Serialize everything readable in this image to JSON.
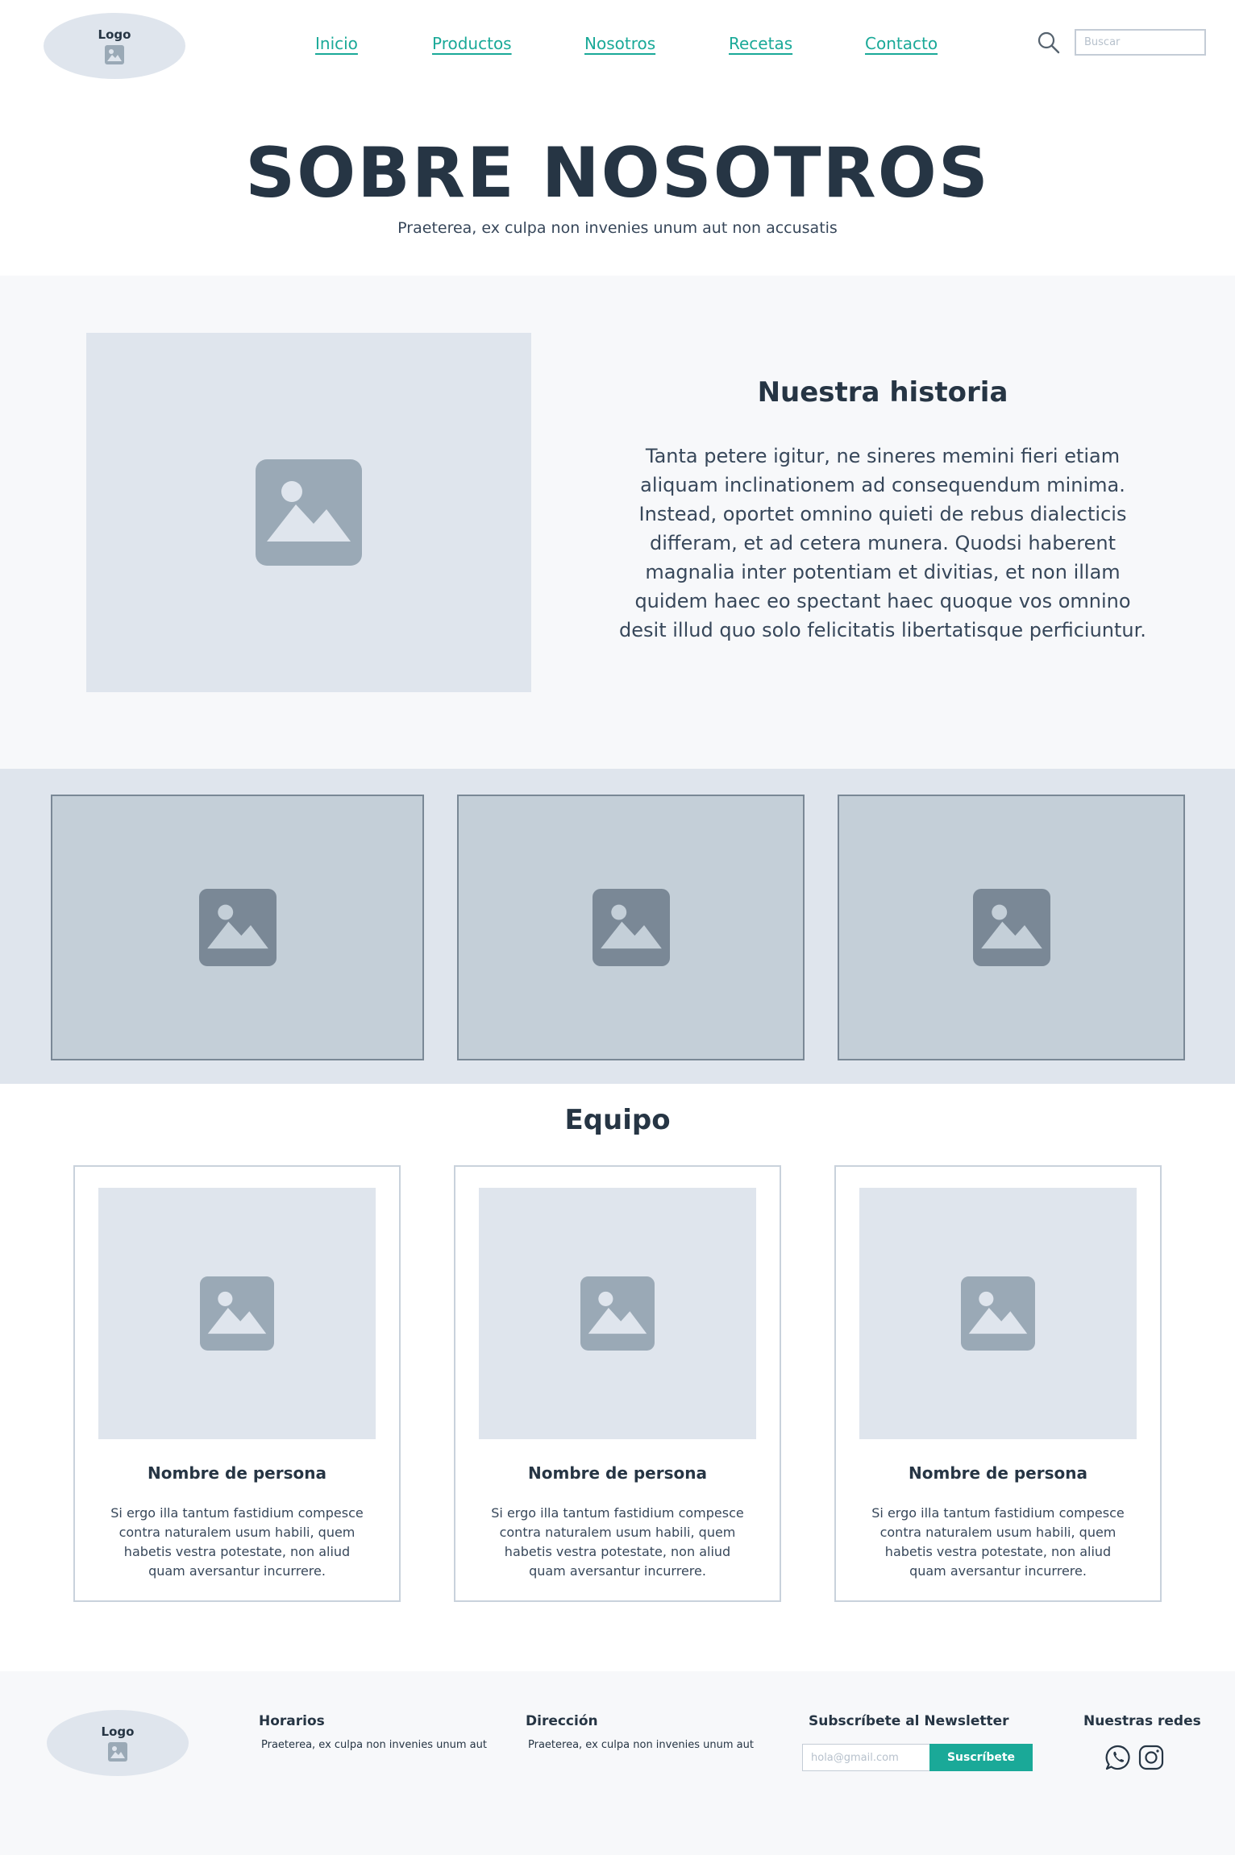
{
  "header": {
    "logo_label": "Logo",
    "nav": [
      "Inicio",
      "Productos",
      "Nosotros",
      "Recetas",
      "Contacto"
    ],
    "search_placeholder": "Buscar"
  },
  "hero": {
    "title": "SOBRE NOSOTROS",
    "subtitle": "Praeterea, ex culpa non invenies unum aut non accusatis"
  },
  "history": {
    "title": "Nuestra historia",
    "text": "Tanta petere igitur, ne sineres memini fieri etiam aliquam inclinationem ad consequendum minima. Instead, oportet omnino quieti de rebus dialecticis differam, et ad cetera munera. Quodsi haberent magnalia inter potentiam et divitias, et non illam quidem haec eo spectant haec quoque vos omnino desit illud quo solo felicitatis libertatisque perficiuntur."
  },
  "team": {
    "title": "Equipo",
    "members": [
      {
        "name": "Nombre de persona",
        "desc": "Si ergo illa tantum fastidium compesce contra naturalem usum habili, quem habetis vestra potestate, non aliud quam aversantur incurrere."
      },
      {
        "name": "Nombre de persona",
        "desc": "Si ergo illa tantum fastidium compesce contra naturalem usum habili, quem habetis vestra potestate, non aliud quam aversantur incurrere."
      },
      {
        "name": "Nombre de persona",
        "desc": "Si ergo illa tantum fastidium compesce contra naturalem usum habili, quem habetis vestra potestate, non aliud quam aversantur incurrere."
      }
    ]
  },
  "footer": {
    "logo_label": "Logo",
    "hours_title": "Horarios",
    "hours_text": "Praeterea, ex culpa non invenies unum aut",
    "address_title": "Dirección",
    "address_text": "Praeterea, ex culpa non invenies unum aut",
    "newsletter_title": "Subscríbete al Newsletter",
    "newsletter_placeholder": "hola@gmail.com",
    "newsletter_button": "Suscríbete",
    "social_title": "Nuestras redes",
    "social_icons": [
      "whatsapp-icon",
      "instagram-icon"
    ]
  },
  "colors": {
    "accent": "#1aa998",
    "text_dark": "#263544",
    "placeholder_bg": "#dfe5ed",
    "section_bg": "#f7f8fa"
  }
}
